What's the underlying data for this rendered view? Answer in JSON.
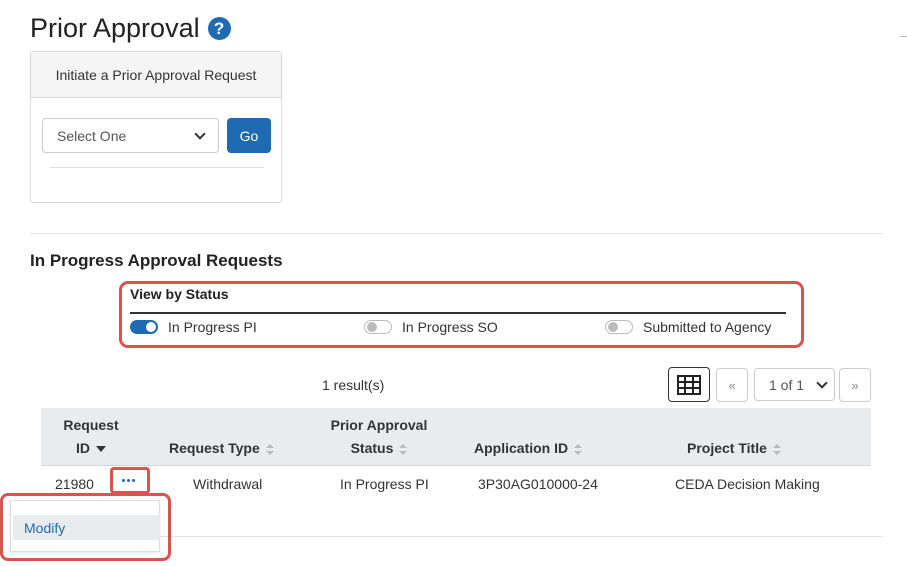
{
  "page": {
    "title": "Prior Approval",
    "help_glyph": "?"
  },
  "initiate": {
    "header": "Initiate a Prior Approval Request",
    "select_value": "Select One",
    "go_label": "Go"
  },
  "section": {
    "title": "In Progress Approval Requests"
  },
  "status_filter": {
    "title": "View by Status",
    "toggles": [
      {
        "label": "In Progress PI",
        "on": true
      },
      {
        "label": "In Progress SO",
        "on": false
      },
      {
        "label": "Submitted to Agency",
        "on": false
      }
    ]
  },
  "results": {
    "count_text": "1 result(s)",
    "prev_label": "«",
    "next_label": "»",
    "page_value": "1 of 1"
  },
  "table": {
    "headers": {
      "request_id_line1": "Request",
      "request_id_line2": "ID",
      "request_type": "Request Type",
      "status_line1": "Prior Approval",
      "status_line2": "Status",
      "application_id": "Application ID",
      "project_title": "Project Title"
    },
    "rows": [
      {
        "request_id": "21980",
        "request_type": "Withdrawal",
        "status": "In Progress PI",
        "application_id": "3P30AG010000-24",
        "project_title": "CEDA Decision Making"
      }
    ]
  },
  "action_menu": {
    "items": [
      "Modify"
    ]
  },
  "colors": {
    "accent": "#1f6bb3",
    "highlight": "#d9534f"
  }
}
